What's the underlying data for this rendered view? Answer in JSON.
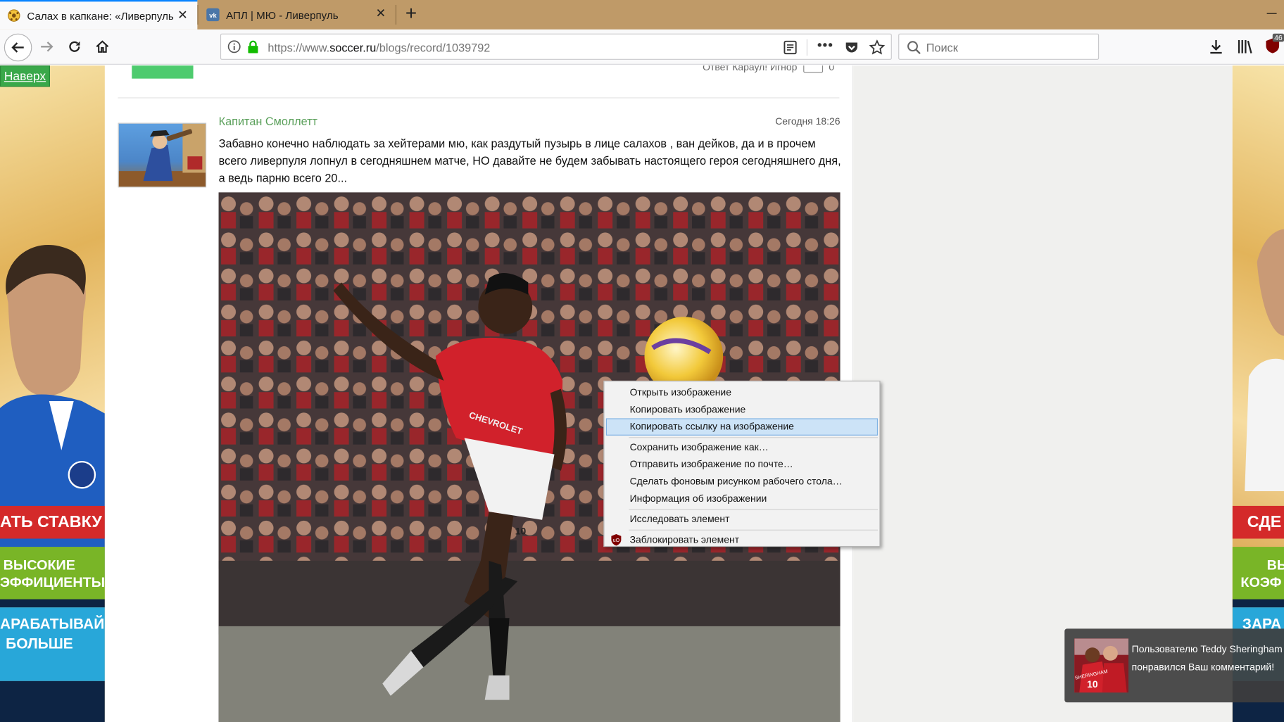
{
  "browser": {
    "tabs": [
      {
        "title": "Салах в капкане: «Ливерпуль",
        "active": true
      },
      {
        "title": "АПЛ | МЮ - Ливерпуль",
        "active": false
      }
    ],
    "url": {
      "scheme": "https://www.",
      "host": "soccer.ru",
      "path": "/blogs/record/1039792"
    },
    "search_placeholder": "Поиск",
    "addon_badge": "46"
  },
  "page": {
    "back_to_top": "Наверх",
    "prev_comment_actions": "Ответ  Караул!  Игнор",
    "prev_comment_likes": "0",
    "comment": {
      "author": "Капитан Смоллетт",
      "time": "Сегодня 18:26",
      "text": "Забавно конечно наблюдать за хейтерами мю, как раздутый пузырь в лице салахов , ван дейков, да и в прочем всего ливерпуля лопнул в сегодняшнем матче, НО давайте не будем забывать настоящего героя сегодняшнего дня, а ведь парню всего 20..."
    },
    "photo_text": {
      "sponsor": "CHEVROLET",
      "number": "10"
    }
  },
  "ads": {
    "left": {
      "red": "АТЬ СТАВКУ",
      "green_line1": "ВЫСОКИЕ",
      "green_line2": "ЭФФИЦИЕНТЫ",
      "blue_line1": "АРАБАТЫВАЙ",
      "blue_line2": "БОЛЬШЕ"
    },
    "right": {
      "red": "СДЕ",
      "green_line1": "ВЫ",
      "green_line2": "КОЭФ",
      "blue_line1": "ЗАРА"
    }
  },
  "context_menu": {
    "items": [
      "Открыть изображение",
      "Копировать изображение",
      "Копировать ссылку на изображение",
      "Сохранить изображение как…",
      "Отправить изображение по почте…",
      "Сделать фоновым рисунком рабочего стола…",
      "Информация об изображении",
      "Исследовать элемент",
      "Заблокировать элемент"
    ],
    "highlighted_index": 2
  },
  "notification": {
    "line1": "Пользователю Teddy Sheringham",
    "line2": "понравился Ваш комментарий!",
    "jersey_name": "SHERINGHAM",
    "jersey_number": "10"
  },
  "colors": {
    "tabbar": "#bf9a68",
    "active_tab_accent": "#0a84ff",
    "author_green": "#5ba05b",
    "menu_highlight": "#cce3f7"
  }
}
